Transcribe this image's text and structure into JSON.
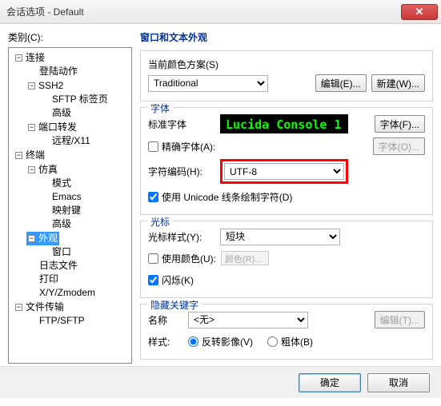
{
  "title": "会话选项 - Default",
  "left_label": "类别(C):",
  "tree": {
    "connection": "连接",
    "login_action": "登陆动作",
    "ssh2": "SSH2",
    "sftp_tab": "SFTP 标签页",
    "advanced1": "高级",
    "port_forward": "端口转发",
    "remote_x11": "远程/X11",
    "terminal": "终端",
    "emulation": "仿真",
    "mode": "模式",
    "emacs": "Emacs",
    "map_keys": "映射键",
    "advanced2": "高级",
    "appearance": "外观",
    "window": "窗口",
    "log_file": "日志文件",
    "print": "打印",
    "xyzmodem": "X/Y/Zmodem",
    "file_transfer": "文件传输",
    "ftpsftp": "FTP/SFTP"
  },
  "appearance_section": {
    "title": "窗口和文本外观",
    "scheme_label": "当前颜色方案(S)",
    "scheme_value": "Traditional",
    "edit_btn": "编辑(E)...",
    "new_btn": "新建(W)..."
  },
  "font_section": {
    "title": "字体",
    "std_font": "标准字体",
    "font_display": "Lucida Console 1",
    "font_btn": "字体(F)...",
    "precise_font": "精确字体(A):",
    "font_o_btn": "字体(O)...",
    "encoding_label": "字符编码(H):",
    "encoding_value": "UTF-8",
    "unicode_chk": "使用 Unicode 线条绘制字符(D)"
  },
  "cursor_section": {
    "title": "光标",
    "style_label": "光标样式(Y):",
    "style_value": "短块",
    "use_color": "使用颜色(U):",
    "color_text": "颜色(R)...",
    "blink": "闪烁(K)"
  },
  "hide_section": {
    "title": "隐藏关键字",
    "name_label": "名称",
    "name_value": "<无>",
    "edit_btn": "编辑(T)...",
    "style_label": "样式:",
    "reverse": "反转影像(V)",
    "bold": "粗体(B)"
  },
  "ok_btn": "确定",
  "cancel_btn": "取消"
}
